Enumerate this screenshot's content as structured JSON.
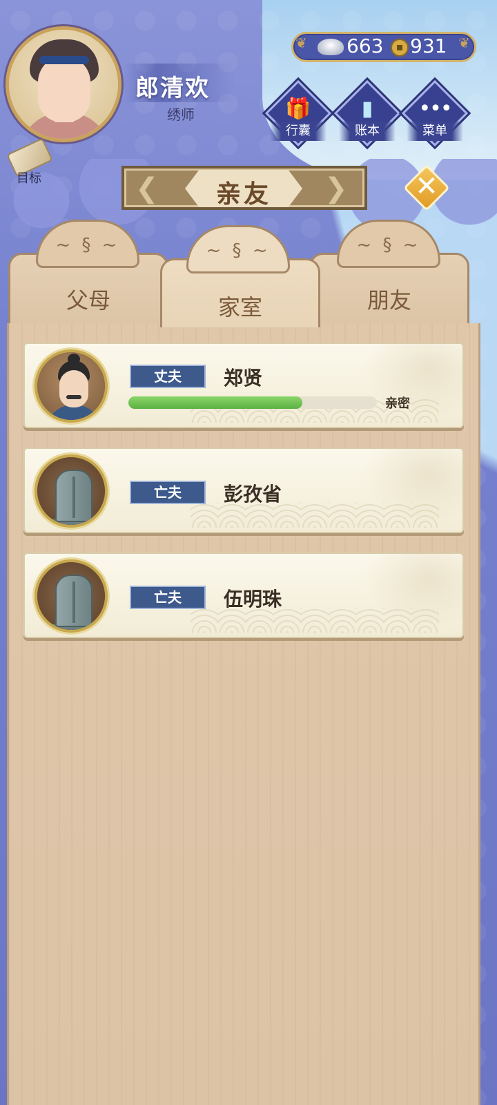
{
  "player": {
    "name": "郎清欢",
    "title": "绣师"
  },
  "goals": {
    "label": "目标"
  },
  "currency": {
    "silver": "663",
    "coins": "931"
  },
  "menu_buttons": [
    {
      "label": "行囊",
      "icon": "bag-icon"
    },
    {
      "label": "账本",
      "icon": "ledger-icon"
    },
    {
      "label": "菜单",
      "icon": "menu-dots-icon"
    }
  ],
  "page_title": "亲友",
  "tabs": [
    {
      "label": "父母",
      "active": false
    },
    {
      "label": "家室",
      "active": true
    },
    {
      "label": "朋友",
      "active": false
    }
  ],
  "relatives": [
    {
      "relation": "丈夫",
      "name": "郑贤",
      "intimacy_label": "亲密",
      "intimacy": 0.7,
      "deceased": false
    },
    {
      "relation": "亡夫",
      "name": "彭孜省",
      "deceased": true
    },
    {
      "relation": "亡夫",
      "name": "伍明珠",
      "deceased": true
    }
  ],
  "colors": {
    "background": "#6f79c6",
    "panel": "#ddc3a6",
    "badge": "#3e5a8c",
    "intimacy_bar": "#5cb143",
    "close_button": "#e19b24"
  }
}
